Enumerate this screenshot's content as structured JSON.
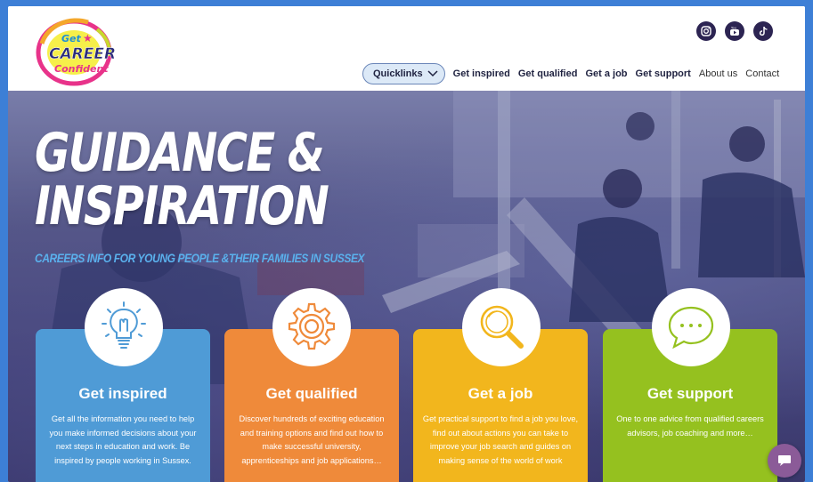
{
  "header": {
    "logo_text_top": "Get",
    "logo_text_main": "CAREER",
    "logo_text_bottom": "Confident",
    "social": [
      "instagram-icon",
      "youtube-icon",
      "tiktok-icon"
    ],
    "nav": {
      "quicklinks": "Quicklinks",
      "items": [
        "Get inspired",
        "Get qualified",
        "Get a job",
        "Get support"
      ],
      "light_items": [
        "About us",
        "Contact"
      ]
    }
  },
  "hero": {
    "headline_line1": "GUIDANCE &",
    "headline_line2": "INSPIRATION",
    "subline": "CAREERS INFO FOR YOUNG PEOPLE &THEIR FAMILIES IN SUSSEX"
  },
  "cards": [
    {
      "title": "Get inspired",
      "desc": "Get all the information you need to help you make informed decisions about your next steps in education and work. Be inspired by people working in Sussex.",
      "color": "#4f9bd6",
      "icon": "lightbulb-icon"
    },
    {
      "title": "Get qualified",
      "desc": "Discover hundreds of exciting education and training options and find out how to make successful university, apprenticeships and job applications…",
      "color": "#ef8a3a",
      "icon": "gear-icon"
    },
    {
      "title": "Get a job",
      "desc": "Get practical support to find a job you love, find out about actions you can take to improve your job search and guides on making sense of the world of work",
      "color": "#f2b61d",
      "icon": "magnifier-icon"
    },
    {
      "title": "Get support",
      "desc": "One to one advice from qualified careers advisors, job coaching and more…",
      "color": "#95c11f",
      "icon": "chat-bubble-icon"
    }
  ],
  "colors": {
    "page_bg": "#3d7fd6",
    "nav_text": "#1f2240",
    "social_icon": "#2c2452",
    "subline": "#5ab0ec",
    "chat_button": "#8b5b98"
  }
}
